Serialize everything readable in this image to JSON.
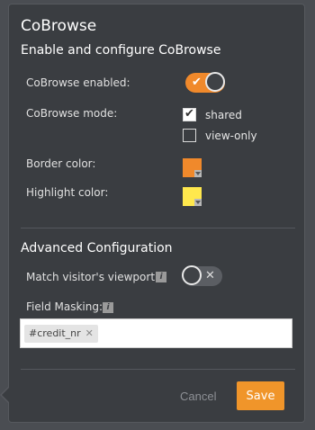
{
  "dialog": {
    "title": "CoBrowse",
    "subtitle": "Enable and configure CoBrowse"
  },
  "settings": {
    "enabled_label": "CoBrowse enabled:",
    "enabled": true,
    "mode_label": "CoBrowse mode:",
    "mode_options": [
      {
        "label": "shared",
        "checked": true
      },
      {
        "label": "view-only",
        "checked": false
      }
    ],
    "border_color_label": "Border color:",
    "border_color": "#f0892b",
    "highlight_color_label": "Highlight color:",
    "highlight_color": "#ffe84d"
  },
  "advanced": {
    "title": "Advanced Configuration",
    "viewport_label": "Match visitor's viewport:",
    "viewport_enabled": false,
    "field_masking_label": "Field Masking:",
    "field_masking_tags": [
      "#credit_nr"
    ]
  },
  "footer": {
    "cancel_label": "Cancel",
    "save_label": "Save"
  }
}
